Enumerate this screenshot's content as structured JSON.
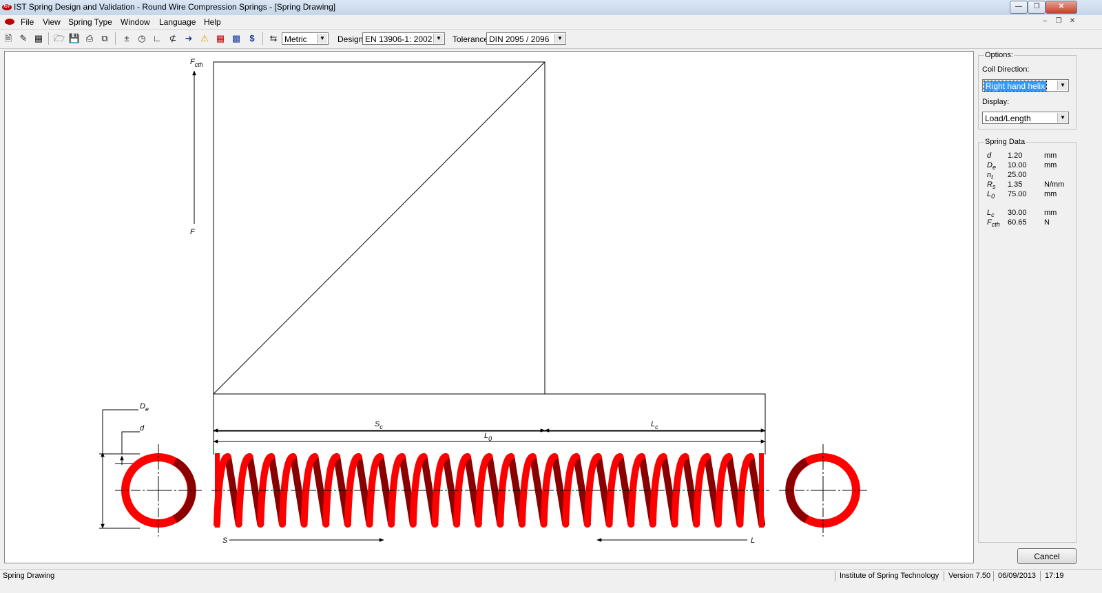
{
  "window": {
    "title": "IST Spring Design and Validation - Round Wire Compression Springs - [Spring Drawing]",
    "logo": "IST"
  },
  "menu": {
    "items": [
      "File",
      "View",
      "Spring Type",
      "Window",
      "Language",
      "Help"
    ]
  },
  "toolbar": {
    "units": "Metric",
    "design_label": "Design:",
    "design_value": "EN 13906-1: 2002",
    "tolerance_label": "Tolerance:",
    "tolerance_value": "DIN 2095 / 2096"
  },
  "drawing": {
    "labels": {
      "fcth": "F",
      "fcth_sub": "cth",
      "f": "F",
      "de": "D",
      "de_sub": "e",
      "d": "d",
      "sc": "S",
      "sc_sub": "c",
      "lc": "L",
      "lc_sub": "c",
      "l0": "L",
      "l0_sub": "0",
      "s": "S",
      "l": "L"
    },
    "colors": {
      "spring_front": "#ff0000",
      "spring_back": "#8b0000",
      "lines": "#000000"
    }
  },
  "options": {
    "title": "Options:",
    "coil_direction_label": "Coil Direction:",
    "coil_direction_value": "Right hand helix",
    "display_label": "Display:",
    "display_value": "Load/Length"
  },
  "spring_data": {
    "title": "Spring Data",
    "rows": [
      {
        "sym": "d",
        "sub": "",
        "value": "1.20",
        "unit": "mm"
      },
      {
        "sym": "D",
        "sub": "e",
        "value": "10.00",
        "unit": "mm"
      },
      {
        "sym": "n",
        "sub": "t",
        "value": "25.00",
        "unit": ""
      },
      {
        "sym": "R",
        "sub": "s",
        "value": "1.35",
        "unit": "N/mm"
      },
      {
        "sym": "L",
        "sub": "0",
        "value": "75.00",
        "unit": "mm"
      },
      {
        "sym": "L",
        "sub": "c",
        "value": "30.00",
        "unit": "mm"
      },
      {
        "sym": "F",
        "sub": "cth",
        "value": "60.65",
        "unit": "N"
      }
    ]
  },
  "buttons": {
    "cancel": "Cancel"
  },
  "status": {
    "left": "Spring Drawing",
    "org": "Institute of Spring Technology",
    "version": "Version 7.50",
    "date": "06/09/2013",
    "time": "17:19"
  }
}
